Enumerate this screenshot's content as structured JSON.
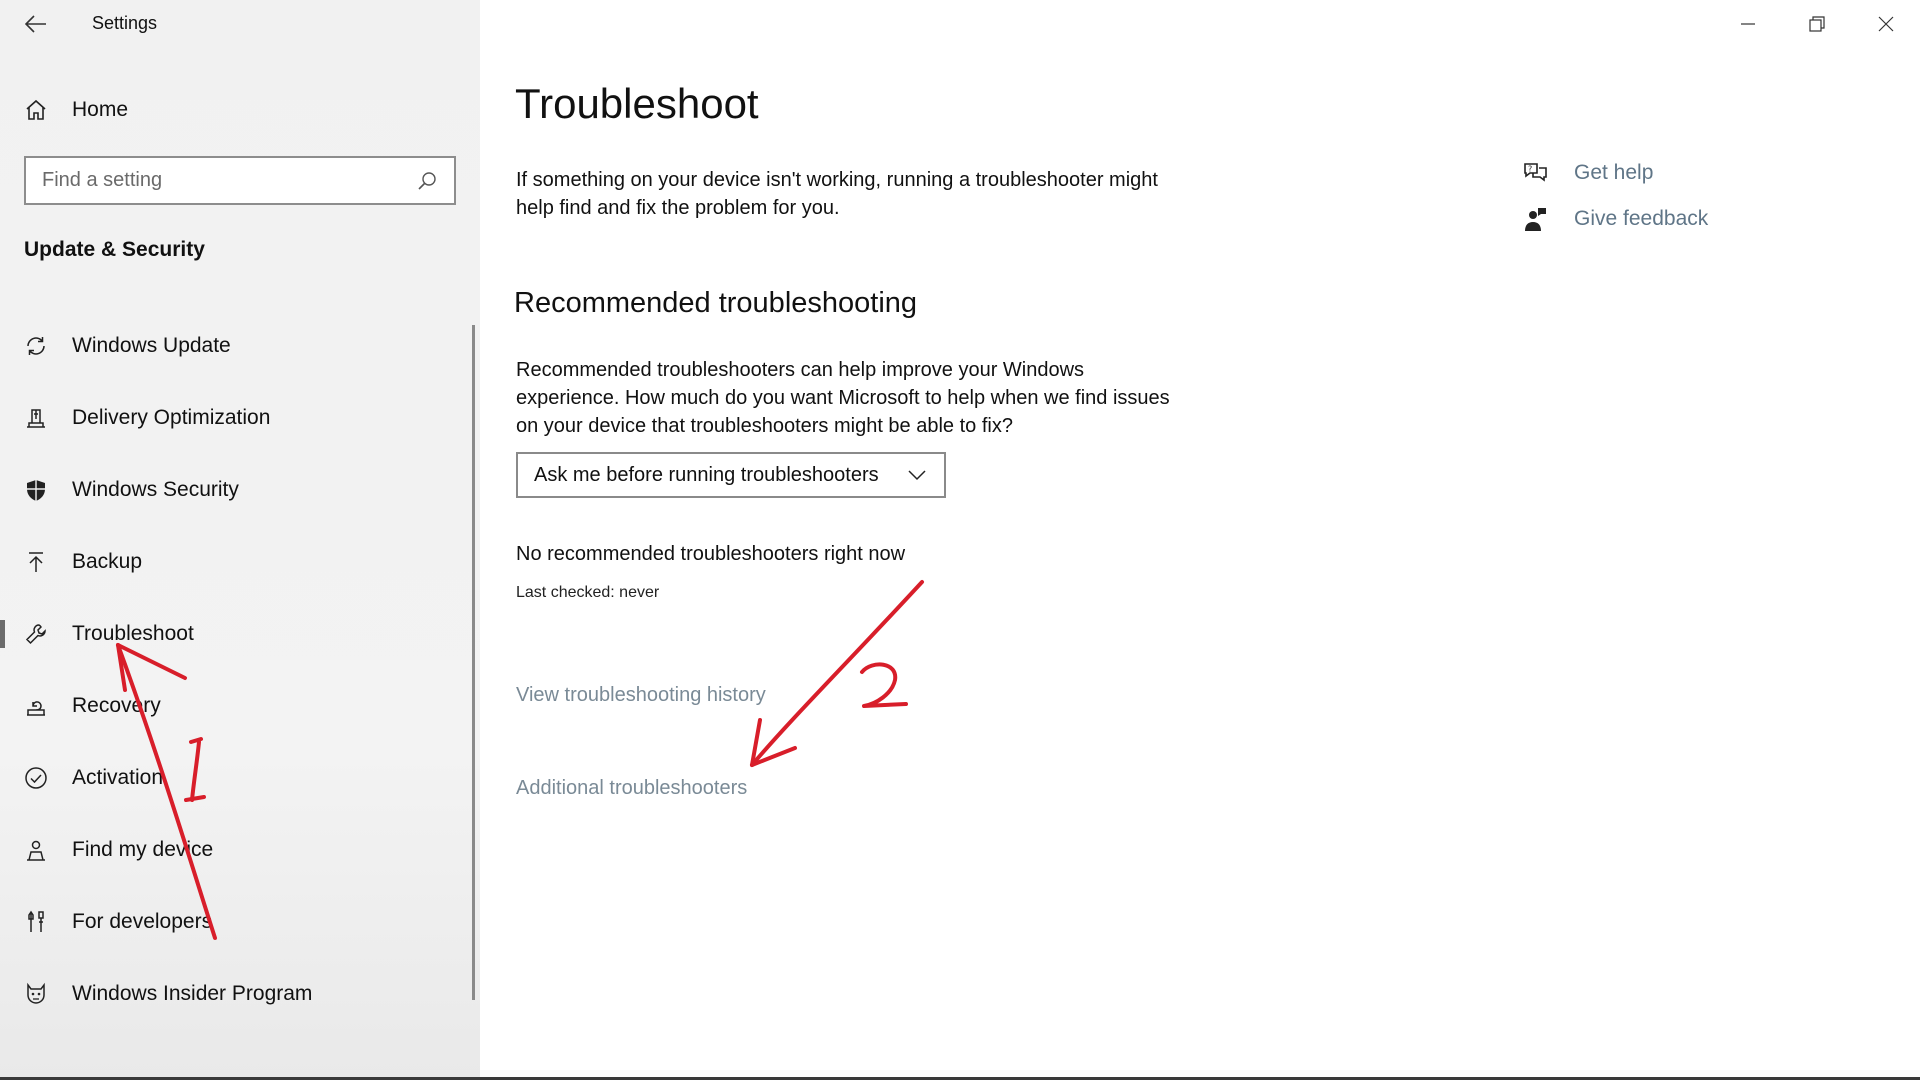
{
  "window": {
    "title": "Settings"
  },
  "sidebar": {
    "home_label": "Home",
    "search_placeholder": "Find a setting",
    "section_title": "Update & Security",
    "items": [
      {
        "label": "Windows Update",
        "icon": "refresh-icon"
      },
      {
        "label": "Delivery Optimization",
        "icon": "delivery-icon"
      },
      {
        "label": "Windows Security",
        "icon": "shield-icon"
      },
      {
        "label": "Backup",
        "icon": "backup-arrow-icon"
      },
      {
        "label": "Troubleshoot",
        "icon": "wrench-icon",
        "selected": true
      },
      {
        "label": "Recovery",
        "icon": "recovery-icon"
      },
      {
        "label": "Activation",
        "icon": "check-circle-icon"
      },
      {
        "label": "Find my device",
        "icon": "person-location-icon"
      },
      {
        "label": "For developers",
        "icon": "developer-tools-icon"
      },
      {
        "label": "Windows Insider Program",
        "icon": "insider-cat-icon"
      }
    ]
  },
  "main": {
    "title": "Troubleshoot",
    "intro": "If something on your device isn't working, running a troubleshooter might help find and fix the problem for you.",
    "recommended_heading": "Recommended troubleshooting",
    "recommended_desc": "Recommended troubleshooters can help improve your Windows experience. How much do you want Microsoft to help when we find issues on your device that troubleshooters might be able to fix?",
    "dropdown_value": "Ask me before running troubleshooters",
    "no_recommended": "No recommended troubleshooters right now",
    "last_checked": "Last checked: never",
    "view_history_link": "View troubleshooting history",
    "additional_link": "Additional troubleshooters"
  },
  "related": {
    "get_help": "Get help",
    "give_feedback": "Give feedback"
  },
  "annotations": {
    "marker_1": "1",
    "marker_2": "2",
    "color": "#d81e2a"
  },
  "colors": {
    "sidebar_bg": "#f2f2f2",
    "link_color": "#7a8a96",
    "related_link_color": "#5f7587"
  }
}
